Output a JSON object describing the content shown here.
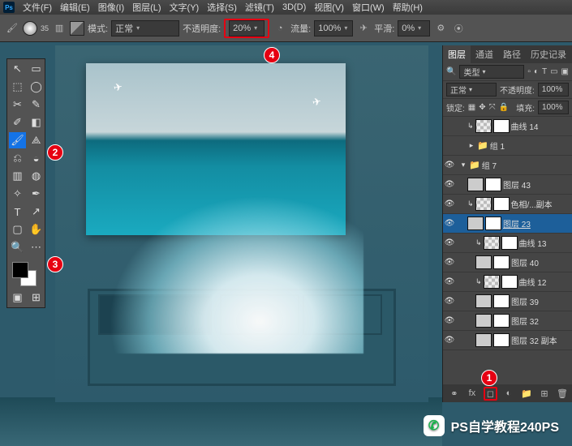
{
  "menu": {
    "items": [
      "文件(F)",
      "编辑(E)",
      "图像(I)",
      "图层(L)",
      "文字(Y)",
      "选择(S)",
      "滤镜(T)",
      "3D(D)",
      "视图(V)",
      "窗口(W)",
      "帮助(H)"
    ]
  },
  "options": {
    "brush_size": "35",
    "mode_label": "模式:",
    "mode_value": "正常",
    "opacity_label": "不透明度:",
    "opacity_value": "20%",
    "flow_label": "流量:",
    "flow_value": "100%",
    "smooth_label": "平滑:",
    "smooth_value": "0%"
  },
  "badges": {
    "b1": "1",
    "b2": "2",
    "b3": "3",
    "b4": "4"
  },
  "panel": {
    "tabs": [
      "图层",
      "通道",
      "路径",
      "历史记录"
    ],
    "kind_label": "类型",
    "blend_value": "正常",
    "opacity_label": "不透明度:",
    "opacity_value": "100%",
    "lock_label": "锁定:",
    "fill_label": "填充:",
    "fill_value": "100%",
    "layers": [
      {
        "eye": "",
        "indent": 1,
        "type": "adj",
        "name": "曲线 14"
      },
      {
        "eye": "",
        "indent": 1,
        "type": "folder",
        "fold": "▸",
        "name": "组 1"
      },
      {
        "eye": "👁",
        "indent": 0,
        "type": "folder",
        "fold": "▾",
        "name": "组 7"
      },
      {
        "eye": "👁",
        "indent": 1,
        "type": "img",
        "name": "图层 43"
      },
      {
        "eye": "👁",
        "indent": 1,
        "type": "adj",
        "name": "色相/...副本"
      },
      {
        "eye": "👁",
        "indent": 1,
        "type": "img",
        "name": "图层 23",
        "sel": true
      },
      {
        "eye": "👁",
        "indent": 2,
        "type": "adj",
        "name": "曲线 13"
      },
      {
        "eye": "👁",
        "indent": 2,
        "type": "img",
        "name": "图层 40"
      },
      {
        "eye": "👁",
        "indent": 2,
        "type": "adj",
        "name": "曲线 12"
      },
      {
        "eye": "👁",
        "indent": 2,
        "type": "img",
        "name": "图层 39"
      },
      {
        "eye": "👁",
        "indent": 2,
        "type": "img",
        "name": "图层 32"
      },
      {
        "eye": "👁",
        "indent": 2,
        "type": "img",
        "name": "图层 32 副本"
      }
    ],
    "foot_fx": "fx"
  },
  "tools": {
    "items": [
      {
        "g": "↖",
        "n": "move-tool"
      },
      {
        "g": "▭",
        "n": "artboard-tool"
      },
      {
        "g": "⬚",
        "n": "marquee-tool"
      },
      {
        "g": "◯",
        "n": "lasso-tool"
      },
      {
        "g": "✂",
        "n": "crop-tool"
      },
      {
        "g": "✎",
        "n": "quick-select-tool"
      },
      {
        "g": "✐",
        "n": "eyedropper-tool"
      },
      {
        "g": "◧",
        "n": "frame-tool"
      },
      {
        "g": "🖌",
        "n": "brush-tool",
        "sel": true
      },
      {
        "g": "⟁",
        "n": "pencil-tool"
      },
      {
        "g": "⎌",
        "n": "clone-tool"
      },
      {
        "g": "◒",
        "n": "eraser-tool"
      },
      {
        "g": "▥",
        "n": "gradient-tool"
      },
      {
        "g": "◍",
        "n": "blur-tool"
      },
      {
        "g": "✧",
        "n": "dodge-tool"
      },
      {
        "g": "✒",
        "n": "pen-tool"
      },
      {
        "g": "T",
        "n": "type-tool"
      },
      {
        "g": "↗",
        "n": "path-tool"
      },
      {
        "g": "▢",
        "n": "shape-tool"
      },
      {
        "g": "✋",
        "n": "hand-tool"
      },
      {
        "g": "🔍",
        "n": "zoom-tool"
      },
      {
        "g": "⋯",
        "n": "more-tool"
      }
    ]
  },
  "watermark": {
    "text": "PS自学教程240PS"
  }
}
